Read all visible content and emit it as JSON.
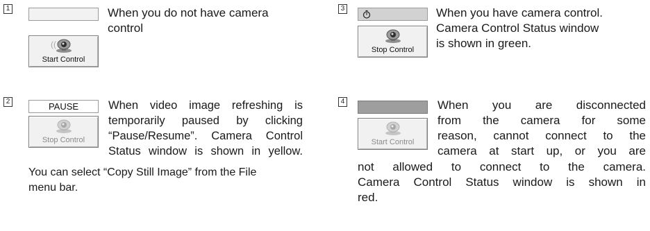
{
  "items": [
    {
      "number": "1",
      "status_text": "",
      "button_label": "Start Control",
      "description": [
        "When you do not have camera",
        "control"
      ]
    },
    {
      "number": "2",
      "status_text": "PAUSE",
      "button_label": "Stop Control",
      "description": [
        "When video image refreshing is",
        "temporarily paused by clicking",
        "“Pause/Resume”. Camera Control",
        "Status window is shown in yellow."
      ],
      "note": [
        "You can select “Copy Still Image” from the File",
        "menu bar."
      ]
    },
    {
      "number": "3",
      "status_text": "",
      "button_label": "Stop Control",
      "description": [
        "When you have camera control.",
        "Camera Control Status window",
        "is shown in green."
      ]
    },
    {
      "number": "4",
      "status_text": "",
      "button_label": "Start Control",
      "description": [
        "When you are disconnected",
        "from the camera for some",
        "reason, cannot connect to the",
        "camera at start up, or you are"
      ],
      "note": [
        "not allowed to connect to the camera.",
        "Camera Control Status window is shown in",
        "red."
      ]
    }
  ],
  "icons": {
    "camera": "camera-icon",
    "signal": "signal-waves-icon",
    "timer": "stopwatch-icon"
  }
}
